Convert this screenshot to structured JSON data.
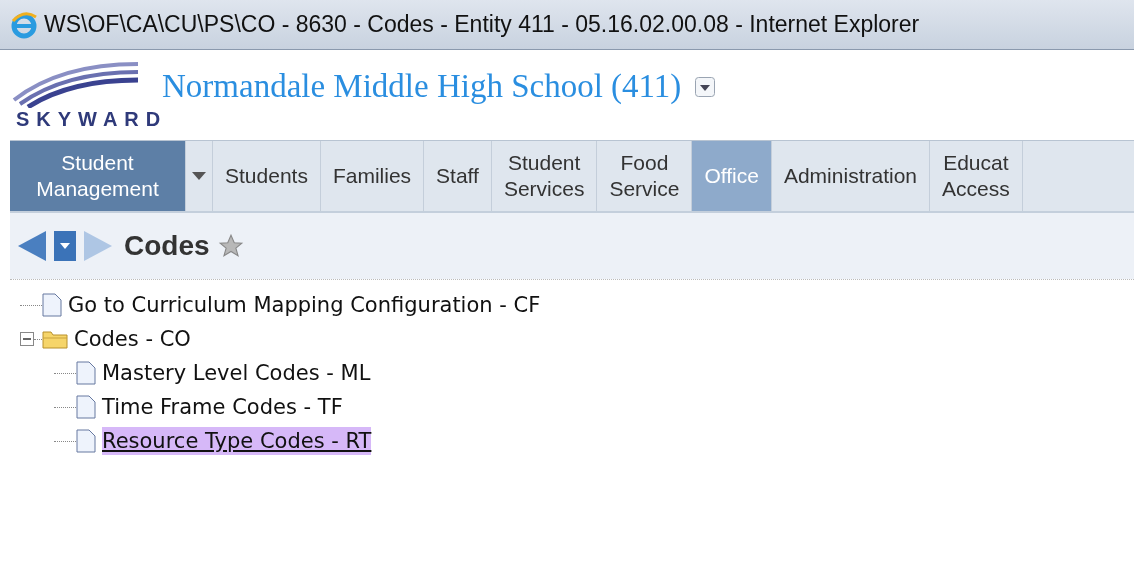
{
  "window": {
    "title": "WS\\OF\\CA\\CU\\PS\\CO - 8630 - Codes - Entity 411 - 05.16.02.00.08 - Internet Explorer"
  },
  "header": {
    "logo": "SKYWARD",
    "school": "Normandale Middle High School (411)"
  },
  "nav": {
    "tabs": [
      {
        "label": "Student Management",
        "kind": "module",
        "selected": true
      },
      {
        "label": "Students",
        "kind": "tab",
        "selected": false
      },
      {
        "label": "Families",
        "kind": "tab",
        "selected": false
      },
      {
        "label": "Staff",
        "kind": "tab",
        "selected": false
      },
      {
        "label": "Student Services",
        "kind": "tab",
        "selected": false
      },
      {
        "label": "Food Service",
        "kind": "tab",
        "selected": false
      },
      {
        "label": "Office",
        "kind": "tab",
        "selected": true
      },
      {
        "label": "Administration",
        "kind": "tab",
        "selected": false
      },
      {
        "label": "Educat Access",
        "kind": "tab",
        "selected": false
      }
    ]
  },
  "page": {
    "title": "Codes"
  },
  "tree": [
    {
      "label": "Go to Curriculum Mapping Configuration - CF",
      "kind": "page",
      "selected": false
    },
    {
      "label": "Codes - CO",
      "kind": "folder",
      "expanded": true,
      "selected": false,
      "children": [
        {
          "label": "Mastery Level Codes - ML",
          "kind": "page",
          "selected": false
        },
        {
          "label": "Time Frame Codes - TF",
          "kind": "page",
          "selected": false
        },
        {
          "label": "Resource Type Codes - RT",
          "kind": "page",
          "selected": true
        }
      ]
    }
  ]
}
